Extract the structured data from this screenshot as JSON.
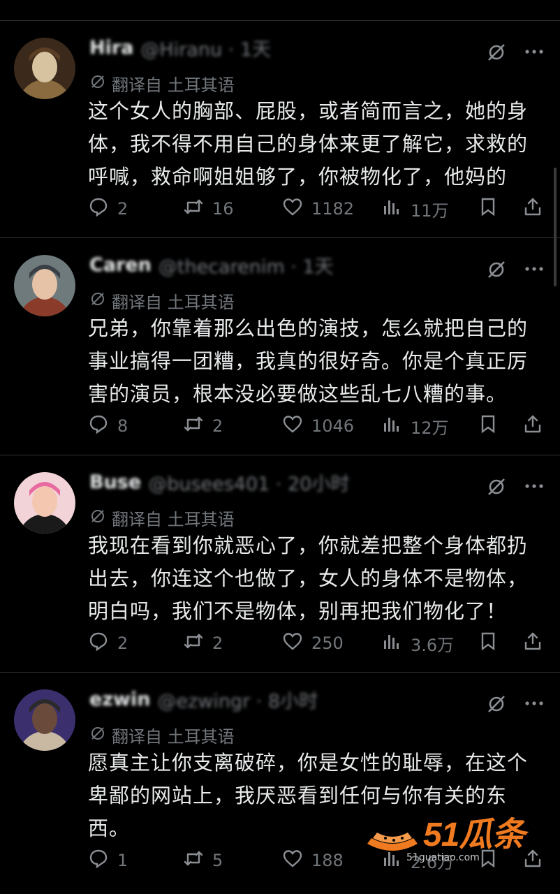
{
  "translate_label": "翻译自 土耳其语",
  "posts": [
    {
      "name": "Hira",
      "handle": "@Hiranu · 1天",
      "text": "这个女人的胸部、屁股，或者简而言之，她的身体，我不得不用自己的身体来更了解它，求救的呼喊，救命啊姐姐够了，你被物化了，他妈的",
      "replies": "2",
      "reposts": "16",
      "likes": "1182",
      "views": "11万",
      "avatar_colors": [
        "#3b2a1c",
        "#8a6b3f",
        "#d8c3a0",
        "#5b3e24"
      ]
    },
    {
      "name": "Caren",
      "handle": "@thecarenim · 1天",
      "text": "兄弟，你靠着那么出色的演技，怎么就把自己的事业搞得一团糟，我真的很好奇。你是个真正厉害的演员，根本没必要做这些乱七八糟的事。",
      "replies": "8",
      "reposts": "2",
      "likes": "1046",
      "views": "12万",
      "avatar_colors": [
        "#6f7a7d",
        "#8b3b2a",
        "#e6c2a6",
        "#3a3f45"
      ]
    },
    {
      "name": "Buse",
      "handle": "@busees401 · 20小时",
      "text": "我现在看到你就恶心了，你就差把整个身体都扔出去，你连这个也做了，女人的身体不是物体，明白吗，我们不是物体，别再把我们物化了！",
      "replies": "2",
      "reposts": "2",
      "likes": "250",
      "views": "3.6万",
      "avatar_colors": [
        "#f2d4d8",
        "#1a1a1a",
        "#f4c7b0",
        "#e86aa0"
      ]
    },
    {
      "name": "ezwin",
      "handle": "@ezwingr · 8小时",
      "text": "愿真主让你支离破碎，你是女性的耻辱，在这个卑鄙的网站上，我厌恶看到任何与你有关的东西。",
      "replies": "1",
      "reposts": "5",
      "likes": "188",
      "views": "2.6万",
      "avatar_colors": [
        "#3b2f6e",
        "#c9b9a3",
        "#6a4a3a",
        "#2a2a2a"
      ]
    }
  ],
  "watermark": {
    "brand": "51瓜条",
    "url": "51guatiao.com",
    "color": "#f07a1f"
  }
}
